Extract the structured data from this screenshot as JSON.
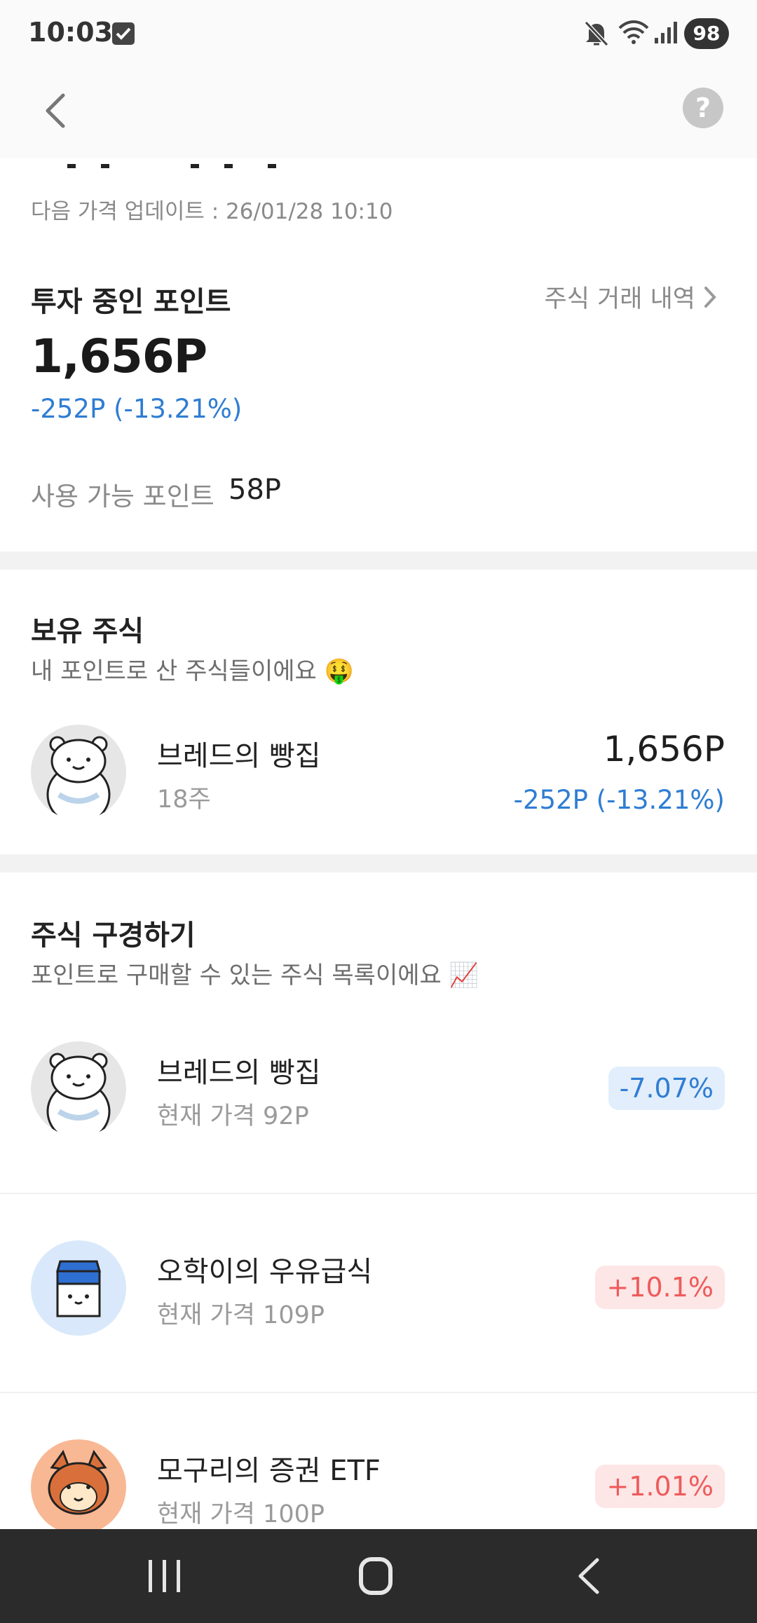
{
  "status_bar": {
    "time": "10:03",
    "battery": "98",
    "icons": [
      "checkbox-notification-icon",
      "mute-icon",
      "wifi-icon",
      "signal-icon"
    ]
  },
  "header": {
    "back_icon": "chevron-left-icon",
    "help_icon": "question-mark-icon",
    "help_glyph": "?"
  },
  "update": {
    "text": "다음 가격 업데이트 : 26/01/28 10:10"
  },
  "invest": {
    "title": "투자 중인 포인트",
    "history_link": "주식 거래 내역",
    "total": "1,656P",
    "change": "-252P (-13.21%)",
    "available_label": "사용 가능 포인트",
    "available_value": "58P"
  },
  "holdings": {
    "title": "보유 주식",
    "subtitle": "내 포인트로 산 주식들이에요 🤑",
    "items": [
      {
        "name": "브레드의 빵집",
        "shares": "18주",
        "value": "1,656P",
        "change": "-252P (-13.21%)",
        "avatar_icon": "bear-avatar-icon"
      }
    ]
  },
  "market": {
    "title": "주식 구경하기",
    "subtitle": "포인트로 구매할 수 있는 주식 목록이에요 📈",
    "items": [
      {
        "name": "브레드의 빵집",
        "price": "현재 가격 92P",
        "rate": "-7.07%",
        "trend": "down",
        "avatar_icon": "bear-avatar-icon"
      },
      {
        "name": "오학이의 우유급식",
        "price": "현재 가격 109P",
        "rate": "+10.1%",
        "trend": "up",
        "avatar_icon": "milk-carton-avatar-icon"
      },
      {
        "name": "모구리의 증권 ETF",
        "price": "현재 가격 100P",
        "rate": "+1.01%",
        "trend": "up",
        "avatar_icon": "fox-avatar-icon"
      }
    ]
  },
  "colors": {
    "negative": "#2f7dd3",
    "positive": "#ee5b5b",
    "negative_bg": "#e2eefb",
    "positive_bg": "#fde6e6"
  },
  "nav_bar": {
    "icons": [
      "recent-apps-icon",
      "home-icon",
      "back-icon"
    ]
  }
}
